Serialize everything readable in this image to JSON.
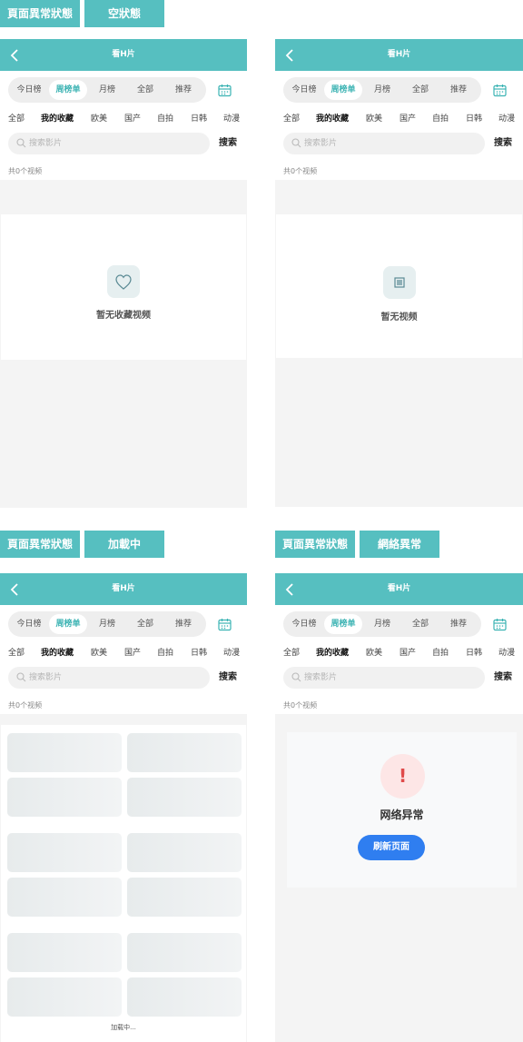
{
  "tags": {
    "p1_state": "頁面異常狀態",
    "p1_mode": "空狀態",
    "p3_state": "頁面異常狀態",
    "p3_mode": "加載中",
    "p4_state": "頁面異常狀態",
    "p4_mode": "網絡異常"
  },
  "header": {
    "title": "看H片"
  },
  "segments": [
    "今日榜",
    "周榜单",
    "月榜",
    "全部",
    "推荐"
  ],
  "categories": [
    "全部",
    "我的收藏",
    "欧美",
    "国产",
    "自拍",
    "日韩",
    "动漫"
  ],
  "search": {
    "placeholder": "搜索影片",
    "button": "搜索"
  },
  "count_text": "共0个视频",
  "empty_favorites": "暂无收藏视频",
  "empty_videos": "暂无视频",
  "loading_text": "加载中...",
  "error": {
    "title": "网络异常",
    "retry": "刷新页面"
  },
  "colors": {
    "accent": "#56bfc0",
    "active_text": "#3bb3b3",
    "error": "#e04b4b",
    "button": "#2f7ef0"
  }
}
